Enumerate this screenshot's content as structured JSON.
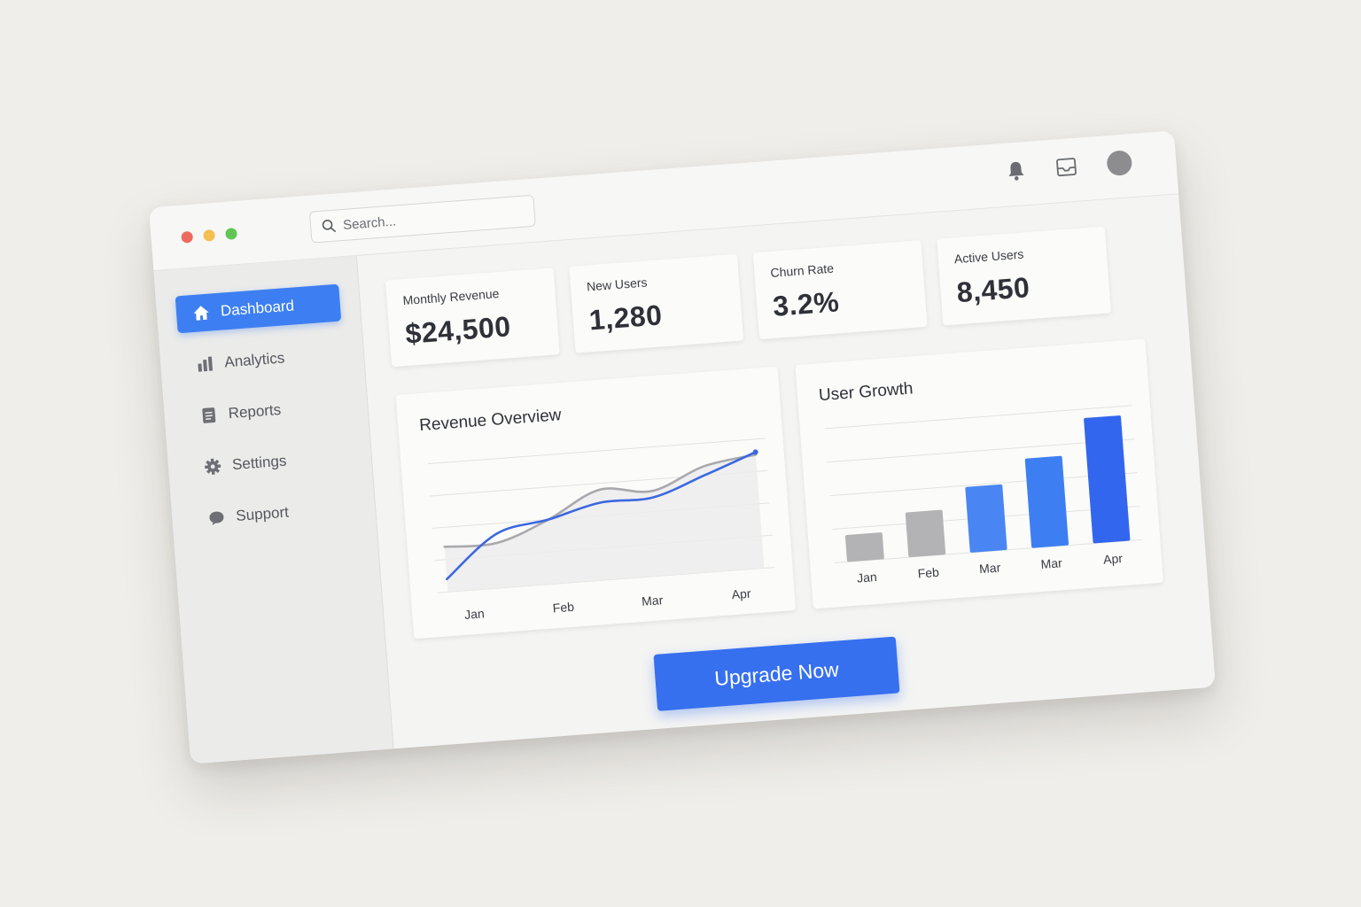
{
  "window": {
    "traffic_lights": [
      "#ec6a5e",
      "#f4bf4f",
      "#61c554"
    ]
  },
  "search": {
    "placeholder": "Search...",
    "icon": "search-icon"
  },
  "top_icons": [
    "bell-icon",
    "inbox-icon",
    "avatar"
  ],
  "sidebar": {
    "items": [
      {
        "label": "Dashboard",
        "icon": "home-icon",
        "active": true
      },
      {
        "label": "Analytics",
        "icon": "bar-chart-icon",
        "active": false
      },
      {
        "label": "Reports",
        "icon": "document-icon",
        "active": false
      },
      {
        "label": "Settings",
        "icon": "gear-icon",
        "active": false
      },
      {
        "label": "Support",
        "icon": "chat-bubble-icon",
        "active": false
      }
    ]
  },
  "stats": [
    {
      "label": "Monthly Revenue",
      "value": "$24,500"
    },
    {
      "label": "New Users",
      "value": "1,280"
    },
    {
      "label": "Churn Rate",
      "value": "3.2%"
    },
    {
      "label": "Active Users",
      "value": "8,450"
    }
  ],
  "chart_data": [
    {
      "type": "line",
      "title": "Revenue Overview",
      "categories": [
        "Jan",
        "Feb",
        "Mar",
        "Apr"
      ],
      "series": [
        {
          "values": [
            10,
            42,
            50,
            60,
            61,
            75,
            90
          ],
          "color": "#3b68e0"
        },
        {
          "values": [
            35,
            35,
            50,
            70,
            66,
            82,
            88
          ],
          "color": "#a9a9ad"
        }
      ],
      "ylim": [
        0,
        100
      ],
      "grid": true
    },
    {
      "type": "bar",
      "title": "User Growth",
      "categories": [
        "Jan",
        "Feb",
        "Mar",
        "Mar",
        "Apr"
      ],
      "values": [
        18,
        30,
        44,
        60,
        84
      ],
      "colors": [
        "#b3b3b5",
        "#b3b3b5",
        "#4a86f3",
        "#3d7ff2",
        "#3366ee"
      ],
      "ylim": [
        0,
        90
      ],
      "grid": true
    }
  ],
  "cta": {
    "label": "Upgrade Now",
    "color": "#3670ef"
  }
}
